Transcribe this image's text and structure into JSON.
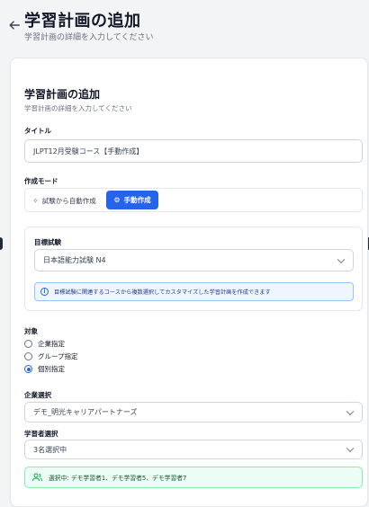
{
  "header": {
    "title": "学習計画の追加",
    "subtitle": "学習計画の詳細を入力してください",
    "back_icon": "arrow-left-icon"
  },
  "card": {
    "title": "学習計画の追加",
    "subtitle": "学習計画の詳細を入力してください"
  },
  "form": {
    "title_label": "タイトル",
    "title_value": "JLPT12月受験コース【手動作成】",
    "mode_label": "作成モード",
    "mode_options": [
      {
        "label": "試験から自動作成",
        "icon": "sparkles-icon",
        "selected": false
      },
      {
        "label": "手動作成",
        "icon": "gear-icon",
        "selected": true
      }
    ],
    "target_exam_label": "目標試験",
    "target_exam_value": "日本語能力試験 N4",
    "info_text": "目標試験に関連するコースから複数選択してカスタマイズした学習計画を作成できます",
    "audience_label": "対象",
    "audience_options": [
      {
        "label": "企業指定",
        "selected": false
      },
      {
        "label": "グループ指定",
        "selected": false
      },
      {
        "label": "個別指定",
        "selected": true
      }
    ],
    "company_label": "企業選択",
    "company_value": "デモ_明光キャリアパートナーズ",
    "learner_label": "学習者選択",
    "learner_value": "3名選択中",
    "selected_text": "選択中: デモ学習者1、デモ学習者5、デモ学習者7"
  },
  "colors": {
    "primary": "#2563eb",
    "info_bg": "#eff6ff",
    "success_bg": "#ecfdf5",
    "success_border": "#86efac"
  }
}
